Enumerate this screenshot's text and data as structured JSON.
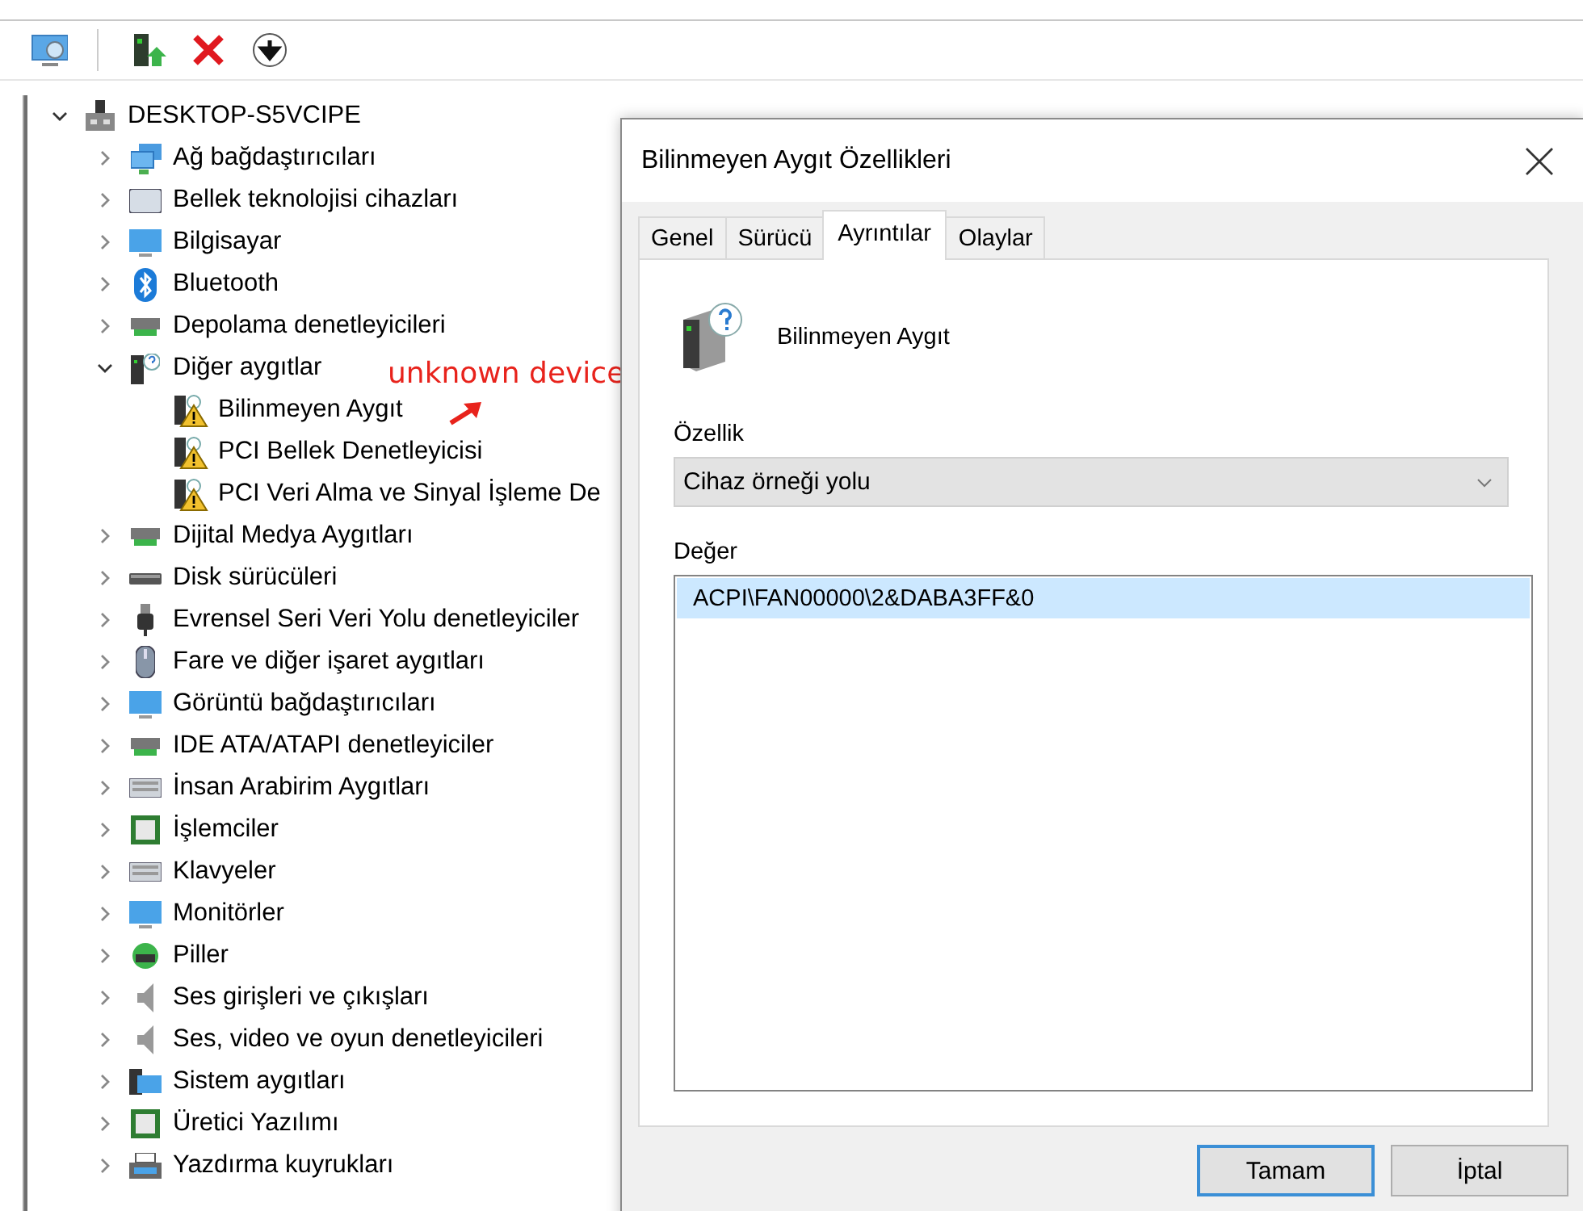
{
  "toolbar": {
    "buttons": [
      {
        "kind": "scan"
      },
      {
        "kind": "update"
      },
      {
        "kind": "remove"
      },
      {
        "kind": "download"
      }
    ]
  },
  "tree": {
    "label": "DESKTOP-S5VCIPE",
    "expanded": true,
    "children": [
      {
        "label": "Ağ bağdaştırıcıları",
        "expanded": false
      },
      {
        "label": "Bellek teknolojisi cihazları",
        "expanded": false
      },
      {
        "label": "Bilgisayar",
        "expanded": false
      },
      {
        "label": "Bluetooth",
        "expanded": false
      },
      {
        "label": "Depolama denetleyicileri",
        "expanded": false
      },
      {
        "label": "Diğer aygıtlar",
        "expanded": true,
        "children": [
          {
            "label": "Bilinmeyen Aygıt",
            "problem": true
          },
          {
            "label": "PCI Bellek Denetleyicisi",
            "problem": true
          },
          {
            "label": "PCI Veri Alma ve Sinyal İşleme De",
            "problem": true
          }
        ]
      },
      {
        "label": "Dijital Medya Aygıtları",
        "expanded": false
      },
      {
        "label": "Disk sürücüleri",
        "expanded": false
      },
      {
        "label": "Evrensel Seri Veri Yolu denetleyiciler",
        "expanded": false
      },
      {
        "label": "Fare ve diğer işaret aygıtları",
        "expanded": false
      },
      {
        "label": "Görüntü bağdaştırıcıları",
        "expanded": false
      },
      {
        "label": "IDE ATA/ATAPI denetleyiciler",
        "expanded": false
      },
      {
        "label": "İnsan Arabirim Aygıtları",
        "expanded": false
      },
      {
        "label": "İşlemciler",
        "expanded": false
      },
      {
        "label": "Klavyeler",
        "expanded": false
      },
      {
        "label": "Monitörler",
        "expanded": false
      },
      {
        "label": "Piller",
        "expanded": false
      },
      {
        "label": "Ses girişleri ve çıkışları",
        "expanded": false
      },
      {
        "label": "Ses, video ve oyun denetleyicileri",
        "expanded": false
      },
      {
        "label": "Sistem aygıtları",
        "expanded": false
      },
      {
        "label": "Üretici Yazılımı",
        "expanded": false
      },
      {
        "label": "Yazdırma kuyrukları",
        "expanded": false
      }
    ]
  },
  "annotation": {
    "text": "unknown device"
  },
  "dialog": {
    "title": "Bilinmeyen Aygıt Özellikleri",
    "tabs": [
      {
        "label": "Genel",
        "selected": false
      },
      {
        "label": "Sürücü",
        "selected": false
      },
      {
        "label": "Ayrıntılar",
        "selected": true
      },
      {
        "label": "Olaylar",
        "selected": false
      }
    ],
    "device_name": "Bilinmeyen Aygıt",
    "property_label": "Özellik",
    "property_value": "Cihaz örneği yolu",
    "value_label": "Değer",
    "values": [
      {
        "text": "ACPI\\FAN00000\\2&DABA3FF&0",
        "selected": true
      }
    ],
    "buttons": [
      {
        "label": "Tamam",
        "default": true
      },
      {
        "label": "İptal",
        "default": false
      }
    ]
  }
}
